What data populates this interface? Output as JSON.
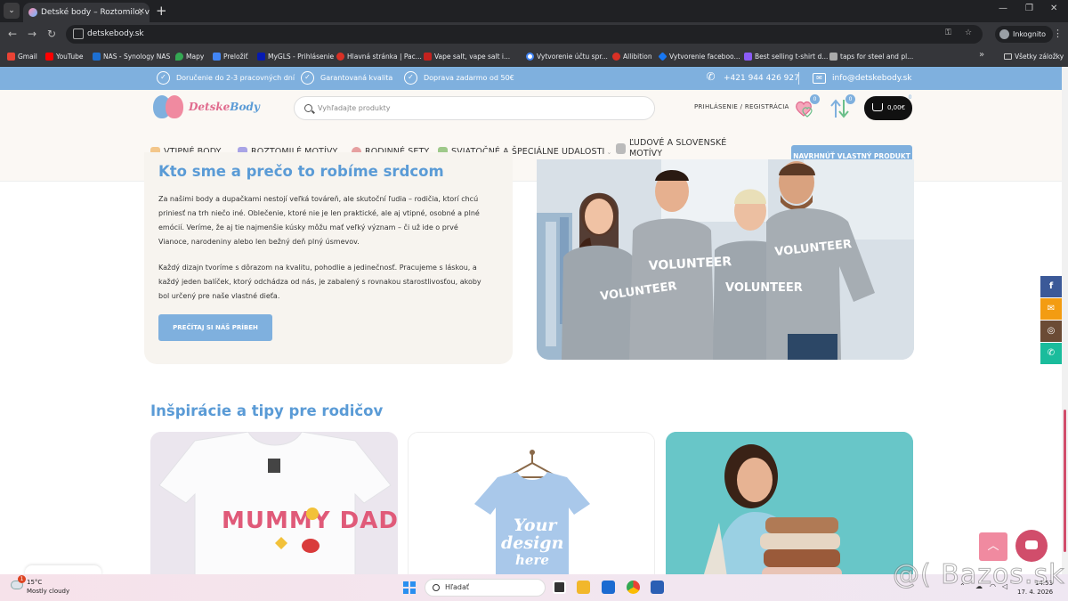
{
  "browser": {
    "tab_title": "Detské body – Roztomilo, vtipn",
    "url": "detskebody.sk",
    "incognito_label": "Inkognito",
    "bookmarks": [
      "Gmail",
      "YouTube",
      "NAS - Synology NAS",
      "Mapy",
      "Preložiť",
      "MyGLS - Prihlásenie",
      "Hlavná stránka | Pac...",
      "Vape salt, vape salt i...",
      "Vytvorenie účtu spr...",
      "Allibition",
      "Vytvorenie faceboo...",
      "Best selling t-shirt d...",
      "taps for steel and pl..."
    ],
    "all_bookmarks": "Všetky záložky"
  },
  "topbar": {
    "delivery": "Doručenie do 2-3 pracovných dní",
    "quality": "Garantovaná kvalita",
    "shipping": "Doprava zadarmo od 50€",
    "phone": "+421 944 426 927",
    "email": "info@detskebody.sk"
  },
  "header": {
    "logo_a": "Detske",
    "logo_b": "Body",
    "search_placeholder": "Vyhľadajte produkty",
    "login": "PRIHLÁSENIE / REGISTRÁCIA",
    "wishlist_count": "0",
    "compare_count": "0",
    "cart_total": "0,00€",
    "cart_count": "0"
  },
  "nav": {
    "items": [
      "VTIPNÉ BODY",
      "ROZTOMILÉ MOTÍVY",
      "RODINNÉ SETY",
      "SVIATOČNÉ A ŠPECIÁLNE UDALOSTI",
      "ĽUDOVÉ A SLOVENSKÉ MOTÍVY"
    ],
    "cta": "NAVRHNÚŤ VLASTNÝ PRODUKT"
  },
  "about": {
    "title": "Kto sme a prečo to robíme srdcom",
    "p1": "Za našimi body a dupačkami nestojí veľká továreň, ale skutoční ľudia – rodičia, ktorí chcú priniesť na trh niečo iné. Oblečenie, ktoré nie je len praktické, ale aj vtipné, osobné a plné emócií. Veríme, že aj tie najmenšie kúsky môžu mať veľký význam – či už ide o prvé Vianoce, narodeniny alebo len bežný deň plný úsmevov.",
    "p2": "Každý dizajn tvoríme s dôrazom na kvalitu, pohodlie a jedinečnosť. Pracujeme s láskou, a každý jeden balíček, ktorý odchádza od nás, je zabalený s rovnakou starostlivosťou, akoby bol určený pre naše vlastné dieťa.",
    "button": "PREČÍTAJ SI NÁŠ PRÍBEH",
    "shirt_text": "VOLUNTEER"
  },
  "inspiration": {
    "title": "Inšpirácie a tipy pre rodičov",
    "card1_text": "MUMMY DADDY",
    "card2_text_1": "Your",
    "card2_text_2": "design",
    "card2_text_3": "here"
  },
  "social": [
    "f",
    "✉",
    "◎",
    "✆"
  ],
  "taskbar": {
    "temp": "15°C",
    "weather": "Mostly cloudy",
    "weather_badge": "1",
    "search": "Hľadať",
    "time": "14:53",
    "date": "17. 4. 2026"
  },
  "watermark": "@( Bazos.sk",
  "colors": {
    "accent": "#7fb0de",
    "heading": "#5a9bd6",
    "pink": "#e06b8e",
    "card_bg": "#f7f4ef"
  }
}
